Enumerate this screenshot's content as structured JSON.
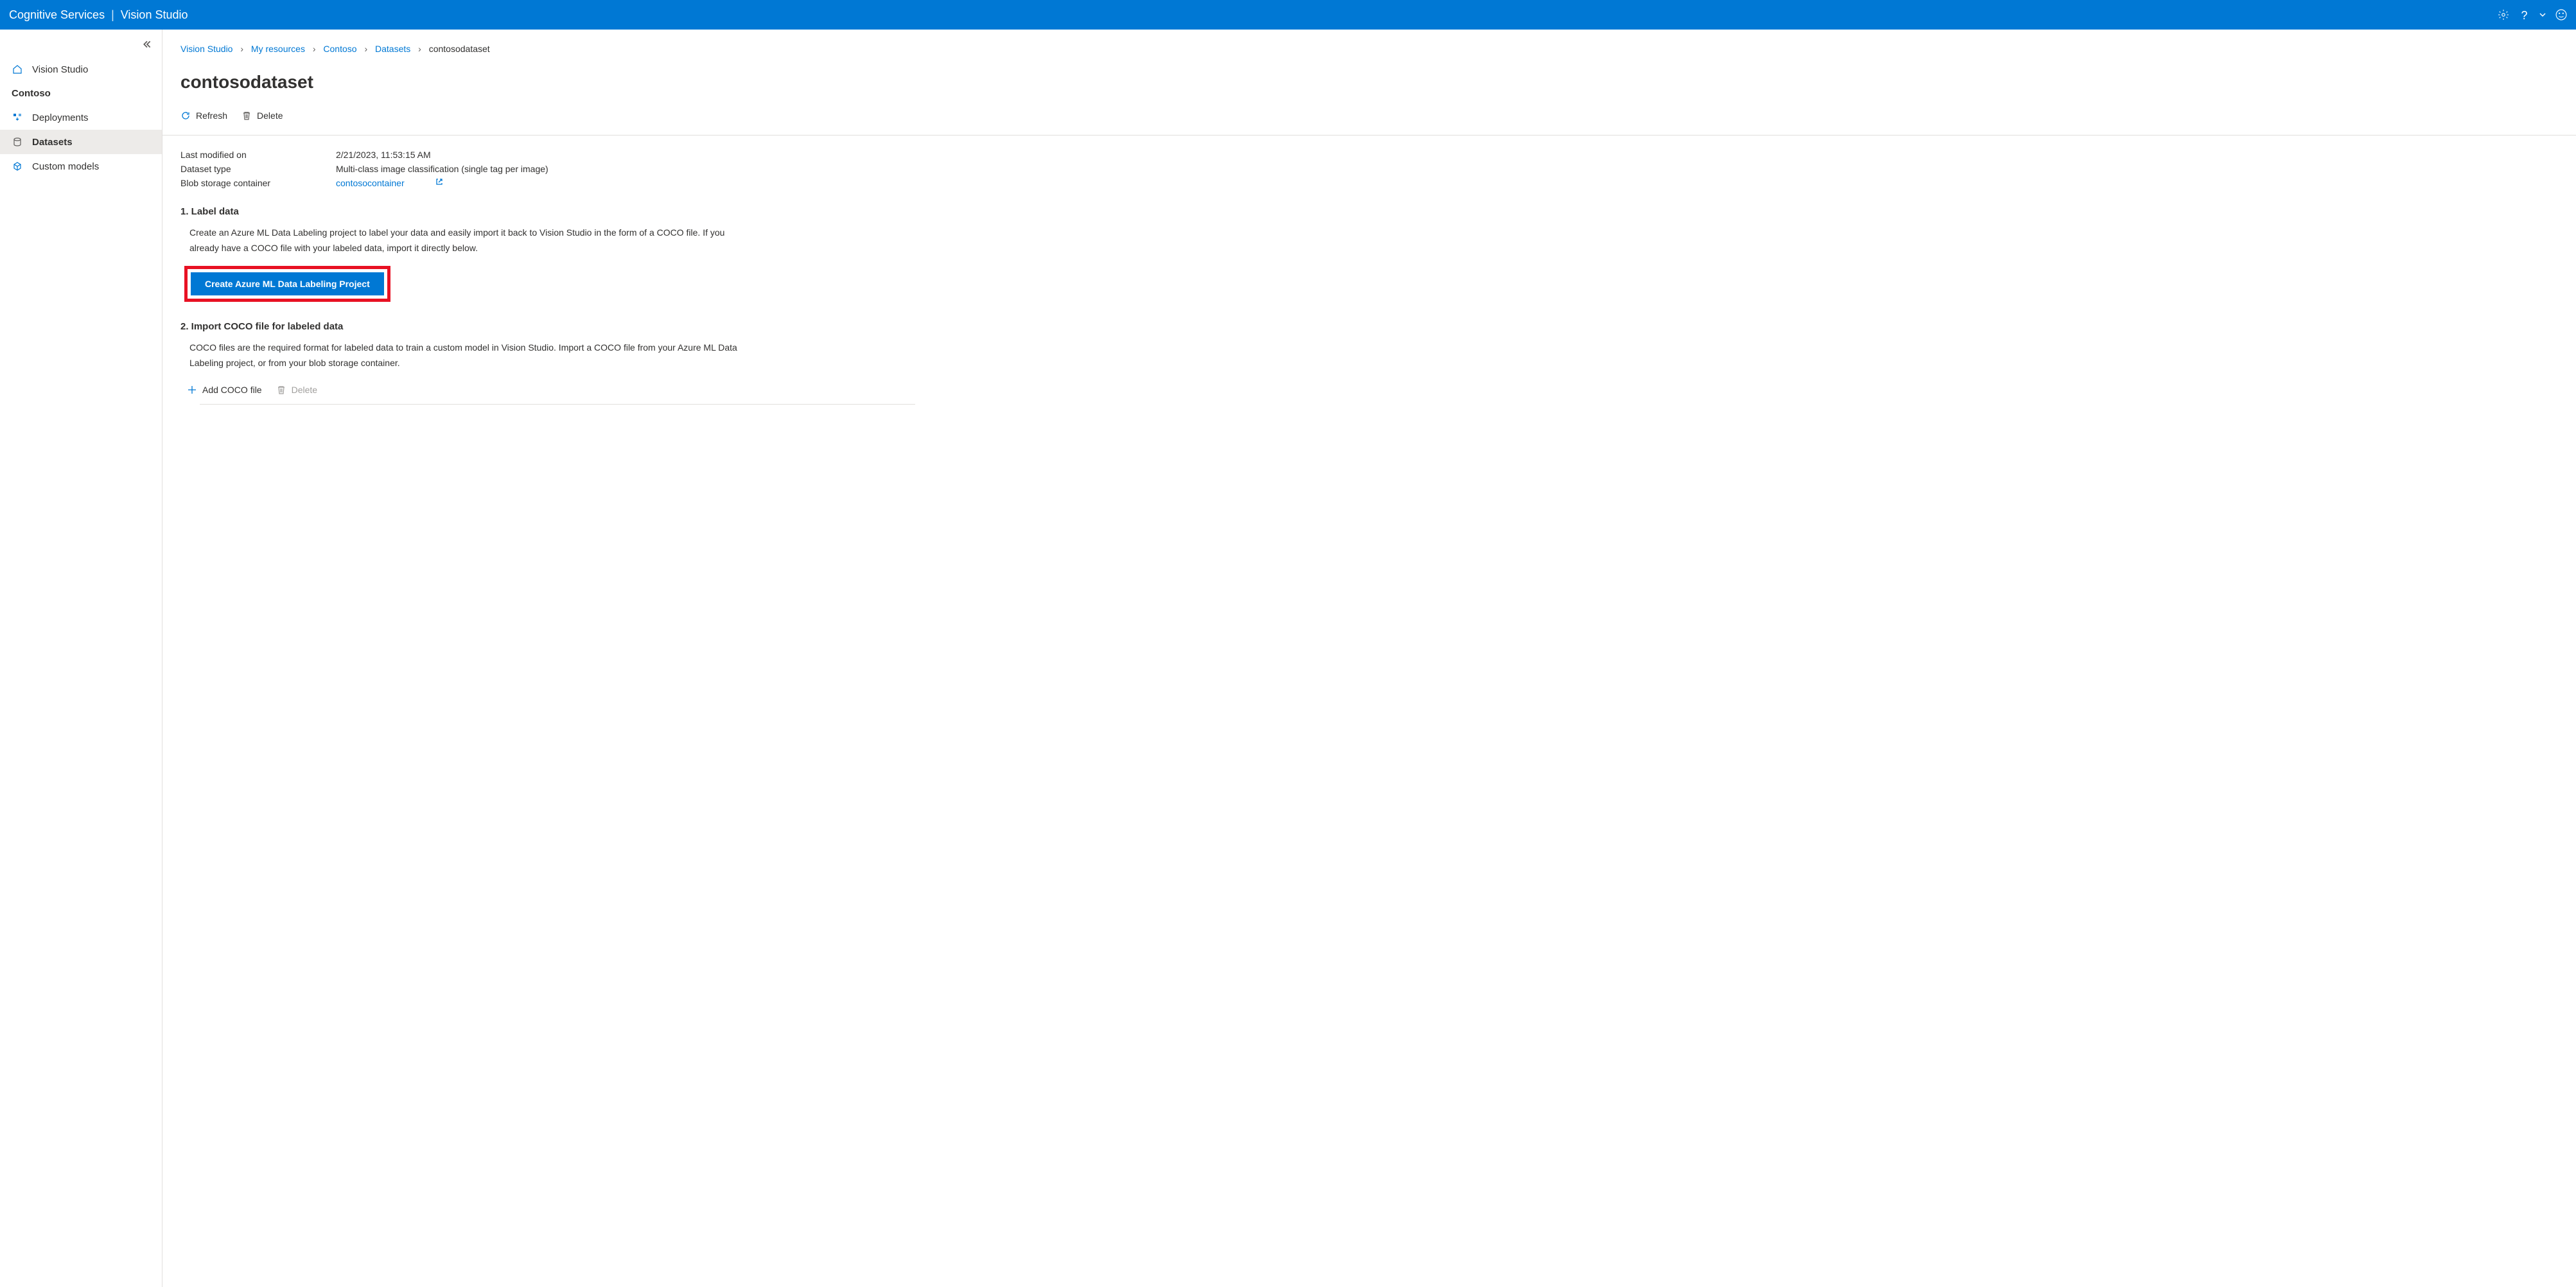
{
  "header": {
    "brand": "Cognitive Services",
    "product": "Vision Studio"
  },
  "sidebar": {
    "home_label": "Vision Studio",
    "resource_label": "Contoso",
    "items": [
      {
        "label": "Deployments"
      },
      {
        "label": "Datasets"
      },
      {
        "label": "Custom models"
      }
    ]
  },
  "breadcrumbs": {
    "items": [
      "Vision Studio",
      "My resources",
      "Contoso",
      "Datasets"
    ],
    "current": "contosodataset"
  },
  "page": {
    "title": "contosodataset"
  },
  "commands": {
    "refresh": "Refresh",
    "delete": "Delete"
  },
  "meta": {
    "last_modified_label": "Last modified on",
    "last_modified_value": "2/21/2023, 11:53:15 AM",
    "dataset_type_label": "Dataset type",
    "dataset_type_value": "Multi-class image classification (single tag per image)",
    "blob_label": "Blob storage container",
    "blob_value": "contosocontainer"
  },
  "section1": {
    "heading": "1. Label data",
    "body": "Create an Azure ML Data Labeling project to label your data and easily import it back to Vision Studio in the form of a COCO file. If you already have a COCO file with your labeled data, import it directly below.",
    "button": "Create Azure ML Data Labeling Project"
  },
  "section2": {
    "heading": "2. Import COCO file for labeled data",
    "body": "COCO files are the required format for labeled data to train a custom model in Vision Studio. Import a COCO file from your Azure ML Data Labeling project, or from your blob storage container.",
    "add": "Add COCO file",
    "delete": "Delete"
  }
}
